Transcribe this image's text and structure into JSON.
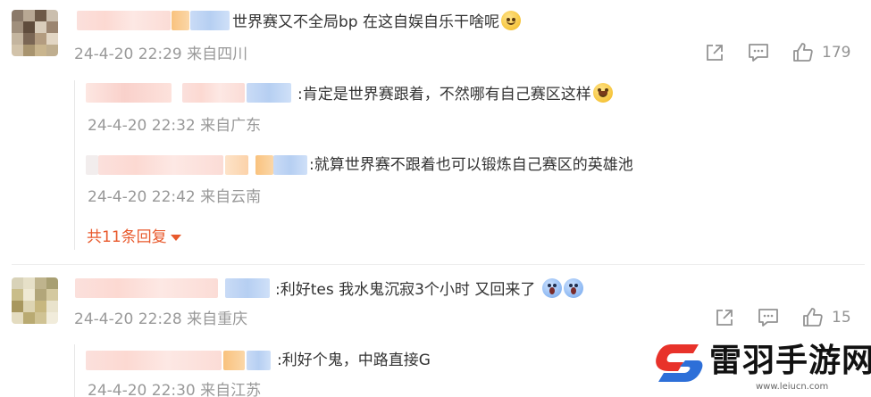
{
  "comments": [
    {
      "text": "世界赛又不全局bp 在这自娱自乐干啥呢",
      "time": "24-4-20 22:29",
      "location": "来自四川",
      "likes": "179",
      "replies": [
        {
          "text": ":肯定是世界赛跟着，不然哪有自己赛区这样",
          "time": "24-4-20 22:32",
          "location": "来自广东"
        },
        {
          "text": ":就算世界赛不跟着也可以锻炼自己赛区的英雄池",
          "time": "24-4-20 22:42",
          "location": "来自云南"
        }
      ],
      "more_replies": "共11条回复"
    },
    {
      "text": ":利好tes 我水鬼沉寂3个小时 又回来了",
      "time": "24-4-20 22:28",
      "location": "来自重庆",
      "likes": "15",
      "replies": [
        {
          "text": ":利好个鬼，中路直接G",
          "time": "24-4-20 22:30",
          "location": "来自江苏"
        }
      ]
    }
  ],
  "watermark": {
    "title": "雷羽手游网",
    "url": "www.leiucn.com"
  },
  "icons": [
    "share-icon",
    "comment-icon",
    "like-icon"
  ],
  "colors": {
    "text": "#333333",
    "meta": "#999999",
    "link": "#e8592c",
    "icon": "#939393",
    "logo_red": "#e8322a",
    "logo_blue": "#2d6fd8"
  }
}
